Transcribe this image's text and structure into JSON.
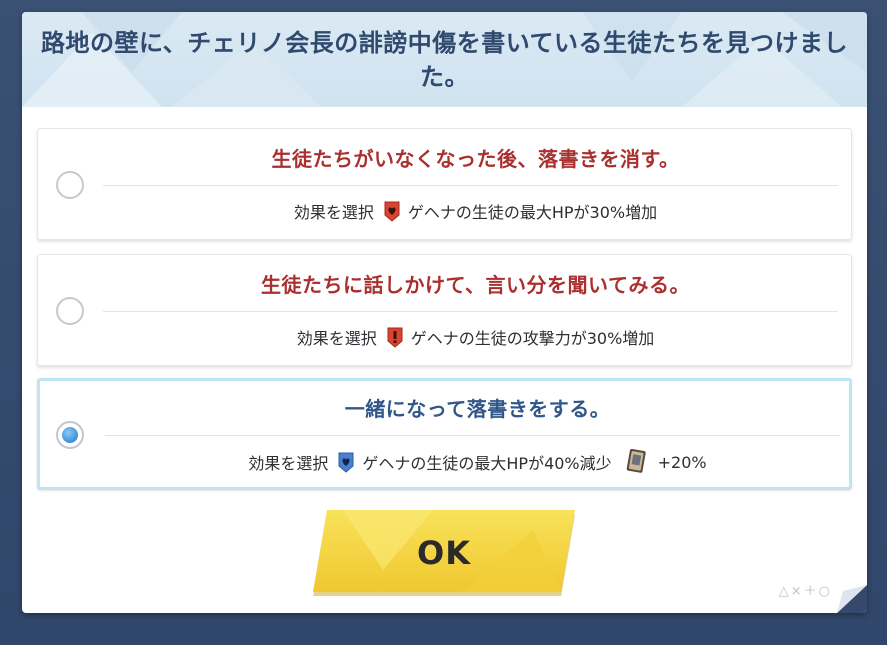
{
  "dialog": {
    "title": "路地の壁に、チェリノ会長の誹謗中傷を書いている生徒たちを見つけました。",
    "ok_label": "OK",
    "decoration": "△×＋○"
  },
  "options": [
    {
      "title": "生徒たちがいなくなった後、落書きを消す。",
      "effect_label": "効果を選択",
      "effect_icon": "red-heart-shield-icon",
      "effect_text": "ゲヘナの生徒の最大HPが30%増加",
      "selected": false
    },
    {
      "title": "生徒たちに話しかけて、言い分を聞いてみる。",
      "effect_label": "効果を選択",
      "effect_icon": "red-exclamation-shield-icon",
      "effect_text": "ゲヘナの生徒の攻撃力が30%増加",
      "selected": false
    },
    {
      "title": "一緒になって落書きをする。",
      "effect_label": "効果を選択",
      "effect_icon": "blue-heart-shield-icon",
      "effect_text": "ゲヘナの生徒の最大HPが40%減少",
      "bonus_icon": "card-icon",
      "bonus_text": "+20%",
      "selected": true
    }
  ],
  "colors": {
    "title": "#2f4a6e",
    "option_title_red": "#a9302f",
    "option_title_blue": "#31578a",
    "ok_button": "#f5d94a",
    "frame": "#34496b"
  }
}
